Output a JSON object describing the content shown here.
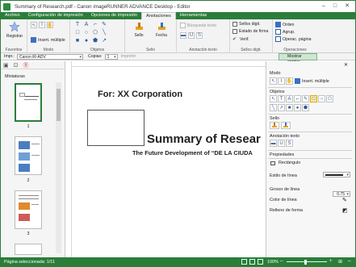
{
  "window": {
    "title": "Summary of Research.pdf - Canon imageRUNNER ADVANCE Desktop - Editor",
    "minimize": "–",
    "maximize": "□",
    "close": "✕"
  },
  "tabs": [
    "Archivo",
    "Configuración de impresión",
    "Opciones de impresión",
    "Anotaciones",
    "Herramientas"
  ],
  "active_tab": "Anotaciones",
  "ribbon": {
    "registrar": "Registrar",
    "favoritos": "Favoritos",
    "modo": "Modo",
    "insert_multiple": "Insert. múltiple",
    "objetos": "Objetos",
    "sello": "Sello",
    "fecha": "Fecha",
    "sello_group": "Sello",
    "busqueda_texto": "Búsqueda texto",
    "anotacion_texto": "Anotación texto",
    "sellos_digit": "Sellos digit.",
    "estado_firma": "Estado de firma",
    "verif": "Verif.",
    "sellos_digit_group": "Sellos digit.",
    "orden": "Orden",
    "agrup": "Agrup.",
    "operac_pagina": "Operac. página",
    "operaciones": "Operaciones"
  },
  "printrow": {
    "printer_label": "Impr.:",
    "printer_value": "Canon iR-ADV",
    "copies_label": "Copias:",
    "copies_value": "1",
    "print_button": "Imprimir",
    "show_annotations": "Mostrar anotac."
  },
  "left_pane": {
    "title": "Miniaturas",
    "pages": [
      "1",
      "2",
      "3"
    ]
  },
  "document": {
    "for_text": "For: XX Corporation",
    "title": "Summary of Resear",
    "subtitle": "The Future Development of “DE LA CIUDA"
  },
  "right_pane": {
    "modo": "Modo",
    "insert_multiple": "Insert. múltiple",
    "objetos": "Objetos",
    "sello": "Sello",
    "anotacion_texto": "Anotación texto",
    "propiedades": "Propiedades",
    "rectangulo": "Rectángulo",
    "estilo_linea": "Estilo de línea",
    "grosor_linea": "Grosor de línea",
    "grosor_value": "0.75",
    "color_linea": "Color de línea",
    "relleno_forma": "Relleno de forma"
  },
  "status": {
    "selected": "Página seleccionada: 1/11",
    "zoom": "100%"
  },
  "colors": {
    "accent": "#2b7d3a",
    "selected_tool": "#fde9a3"
  }
}
